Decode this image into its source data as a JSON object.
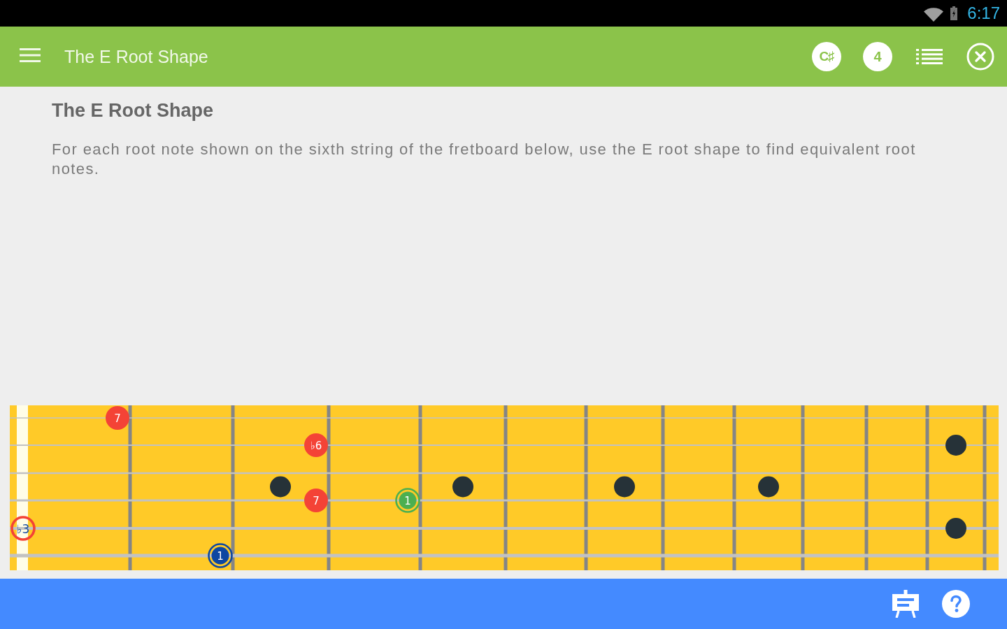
{
  "status_bar": {
    "time": "6:17"
  },
  "app_bar": {
    "title": "The E Root Shape",
    "badges": [
      {
        "kind": "key",
        "label": "C♯"
      },
      {
        "kind": "count",
        "label": "4"
      }
    ]
  },
  "lesson": {
    "heading": "The E Root Shape",
    "instructions": "For each root note shown on the sixth string of the fretboard below, use the E root shape to find equivalent root notes."
  },
  "fretboard": {
    "notes": [
      {
        "label": "7",
        "kind": "solid",
        "color": "#f44336"
      },
      {
        "label": "♭6",
        "kind": "solid",
        "color": "#f44336"
      },
      {
        "label": "7",
        "kind": "solid",
        "color": "#f44336"
      },
      {
        "label": "1",
        "kind": "ring",
        "color": "#4caf50"
      },
      {
        "label": "♭3",
        "kind": "outline",
        "color": "#f44336"
      },
      {
        "label": "1",
        "kind": "ring",
        "color": "#0d47a1"
      }
    ]
  }
}
